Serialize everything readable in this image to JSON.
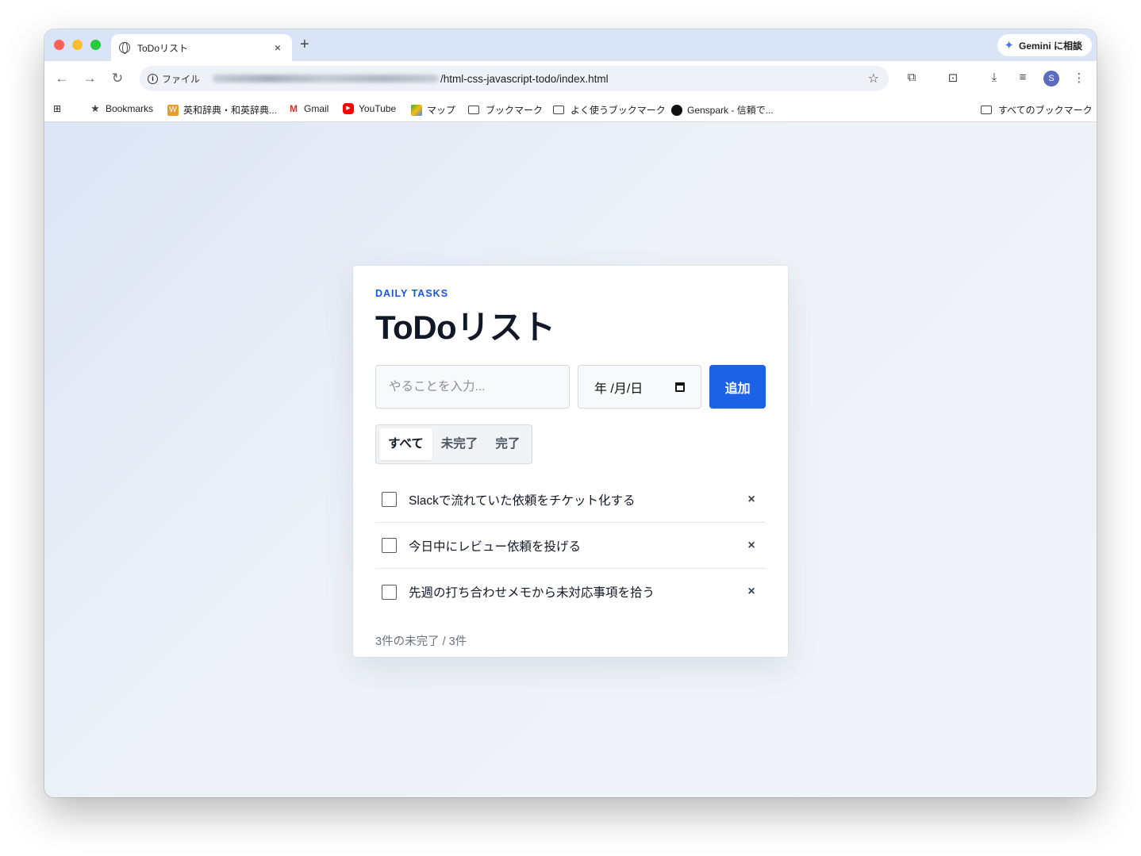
{
  "browser": {
    "tab_title": "ToDoリスト",
    "tab_close": "×",
    "new_tab": "+",
    "gemini_label": "Gemini に相談",
    "omnibox_scheme": "ファイル",
    "url_path": "/html-css-javascript-todo/index.html",
    "bookmarks": [
      {
        "label": "Bookmarks",
        "icon": "star-icon"
      },
      {
        "label": "英和辞典・和英辞典...",
        "icon": "weblio-icon"
      },
      {
        "label": "Gmail",
        "icon": "gmail-icon"
      },
      {
        "label": "YouTube",
        "icon": "youtube-icon"
      },
      {
        "label": "マップ",
        "icon": "maps-icon"
      },
      {
        "label": "ブックマーク",
        "icon": "folder-icon"
      },
      {
        "label": "よく使うブックマーク",
        "icon": "folder-icon"
      },
      {
        "label": "Genspark - 信頼で...",
        "icon": "genspark-icon"
      }
    ],
    "all_bookmarks": "すべてのブックマーク",
    "avatar_letter": "S"
  },
  "app": {
    "kicker": "DAILY TASKS",
    "title": "ToDoリスト",
    "input_placeholder": "やることを入力...",
    "date_placeholder": "年 /月/日",
    "add_button": "追加",
    "filters": [
      "すべて",
      "未完了",
      "完了"
    ],
    "active_filter": "すべて",
    "tasks": [
      {
        "text": "Slackで流れていた依頼をチケット化する",
        "done": false
      },
      {
        "text": "今日中にレビュー依頼を投げる",
        "done": false
      },
      {
        "text": "先週の打ち合わせメモから未対応事項を拾う",
        "done": false
      }
    ],
    "summary": "3件の未完了 / 3件",
    "delete_glyph": "×"
  },
  "colors": {
    "accent": "#1c62e6",
    "kicker": "#1a56db",
    "title": "#111827"
  }
}
